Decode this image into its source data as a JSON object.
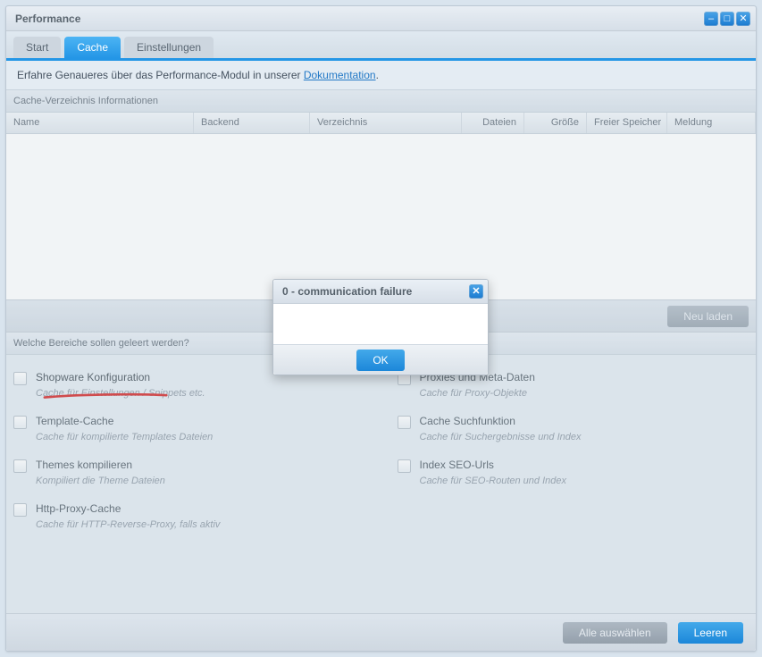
{
  "window": {
    "title": "Performance"
  },
  "win_ctrl": {
    "min": "–",
    "max": "□",
    "close": "✕"
  },
  "tabs": {
    "start": "Start",
    "cache": "Cache",
    "settings": "Einstellungen"
  },
  "banner": {
    "text": "Erfahre Genaueres über das Performance-Modul in unserer ",
    "link_label": "Dokumentation",
    "period": "."
  },
  "grid": {
    "title": "Cache-Verzeichnis Informationen",
    "cols": {
      "name": "Name",
      "backend": "Backend",
      "dir": "Verzeichnis",
      "files": "Dateien",
      "size": "Größe",
      "free": "Freier Speicher",
      "msg": "Meldung"
    },
    "reload_btn": "Neu laden"
  },
  "clear": {
    "title": "Welche Bereiche sollen geleert werden?",
    "left": [
      {
        "title": "Shopware Konfiguration",
        "desc": "Cache für Einstellungen / Snippets etc."
      },
      {
        "title": "Template-Cache",
        "desc": "Cache für kompilierte Templates Dateien"
      },
      {
        "title": "Themes kompilieren",
        "desc": "Kompiliert die Theme Dateien"
      },
      {
        "title": "Http-Proxy-Cache",
        "desc": "Cache für HTTP-Reverse-Proxy, falls aktiv"
      }
    ],
    "right": [
      {
        "title": "Proxies und Meta-Daten",
        "desc": "Cache für Proxy-Objekte"
      },
      {
        "title": "Cache Suchfunktion",
        "desc": "Cache für Suchergebnisse und Index"
      },
      {
        "title": "Index SEO-Urls",
        "desc": "Cache für SEO-Routen und Index"
      }
    ]
  },
  "footer": {
    "select_all": "Alle auswählen",
    "clear": "Leeren"
  },
  "modal": {
    "title": "0 - communication failure",
    "ok": "OK"
  }
}
